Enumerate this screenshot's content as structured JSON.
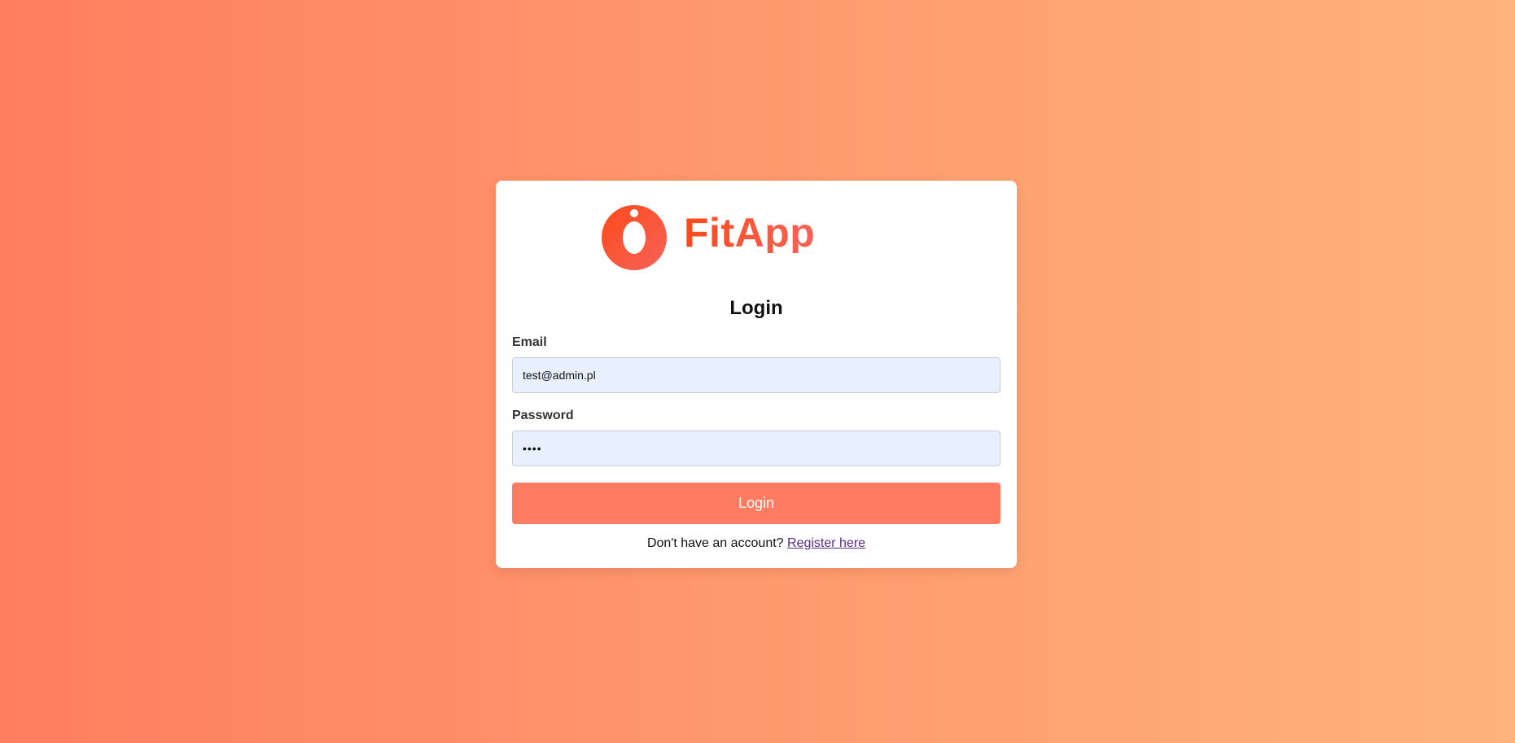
{
  "brand": {
    "name": "FitApp",
    "logo_icon": "fitapp-logo-icon",
    "gradient_start": "#fc4a1a",
    "gradient_end": "#f7635a"
  },
  "form": {
    "title": "Login",
    "email": {
      "label": "Email",
      "value": "test@admin.pl"
    },
    "password": {
      "label": "Password",
      "value": "••••"
    },
    "submit_label": "Login",
    "register_prompt": "Don't have an account?",
    "register_link": "Register here"
  },
  "colors": {
    "background_start": "#ff7e5f",
    "background_end": "#ffb47b",
    "button": "#ff7b61",
    "input_background": "#e8f0fe",
    "link": "#5b2a86"
  }
}
